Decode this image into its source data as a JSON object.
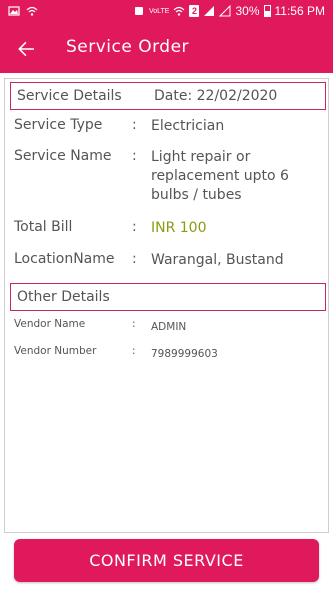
{
  "status_bar": {
    "volte_badge": "VoLTE",
    "sim_badge": "2",
    "battery_percent": "30%",
    "time": "11:56 PM"
  },
  "app_bar": {
    "title": "Service Order"
  },
  "service_details": {
    "heading": "Service Details",
    "date_label": "Date: 22/02/2020",
    "rows": [
      {
        "label": "Service Type",
        "sep": ":",
        "value": "Electrician"
      },
      {
        "label": "Service Name",
        "sep": ":",
        "value": "Light repair or replacement upto 6 bulbs / tubes"
      },
      {
        "label": "Total Bill",
        "sep": ":",
        "value": "INR 100"
      },
      {
        "label": "LocationName",
        "sep": ":",
        "value": "Warangal, Bustand"
      }
    ]
  },
  "other_details": {
    "heading": "Other Details",
    "rows": [
      {
        "label": "Vendor Name",
        "sep": ":",
        "value": "ADMIN"
      },
      {
        "label": "Vendor Number",
        "sep": ":",
        "value": "7989999603"
      }
    ]
  },
  "actions": {
    "confirm_label": "CONFIRM SERVICE"
  },
  "colors": {
    "primary": "#e0195c",
    "amount": "#8c9a12"
  }
}
